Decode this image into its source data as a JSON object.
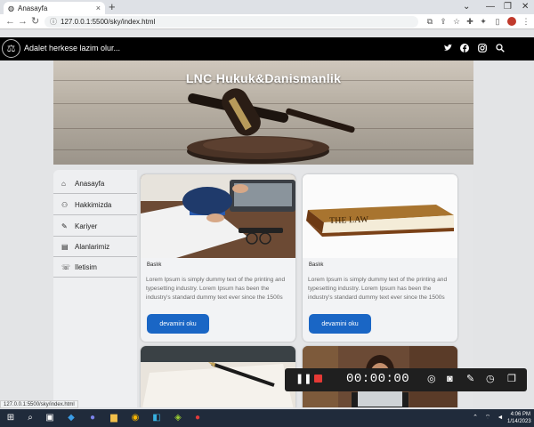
{
  "browser": {
    "tab_title": "Anasayfa",
    "tab_close": "×",
    "new_tab": "+",
    "url": "127.0.0.1:5500/sky/index.html",
    "window_controls": [
      "⌄",
      "—",
      "❐",
      "✕"
    ]
  },
  "site": {
    "brand": "Adalet herkese lazim olur...",
    "hero_title": "LNC Hukuk&Danismanlik",
    "social_icons": [
      "twitter-icon",
      "facebook-icon",
      "instagram-icon",
      "search-icon"
    ],
    "sidebar": [
      {
        "label": "Anasayfa",
        "icon": "home-icon"
      },
      {
        "label": "Hakkimizda",
        "icon": "users-icon"
      },
      {
        "label": "Kariyer",
        "icon": "edit-icon"
      },
      {
        "label": "Alanlarimiz",
        "icon": "book-icon"
      },
      {
        "label": "Iletisim",
        "icon": "contact-icon"
      }
    ],
    "cards": [
      {
        "title": "Baslık",
        "text": "Lorem Ipsum is simply dummy text of the printing and typesetting industry. Lorem Ipsum has been the industry's standard dummy text ever since the 1500s",
        "button": "devamini oku"
      },
      {
        "title": "Baslık",
        "text": "Lorem Ipsum is simply dummy text of the printing and typesetting industry. Lorem Ipsum has been the industry's standard dummy text ever since the 1500s",
        "button": "devamini oku"
      }
    ],
    "book_label": "THE LAW"
  },
  "recorder": {
    "timer": "00:00:00"
  },
  "status_url": "127.0.0.1:5500/sky/index.html",
  "taskbar": {
    "time": "4:06 PM",
    "date": "1/14/2023"
  },
  "colors": {
    "accent": "#1a66c5",
    "nav_bg": "#000000",
    "record": "#e53935",
    "taskbar": "#202b3b"
  }
}
